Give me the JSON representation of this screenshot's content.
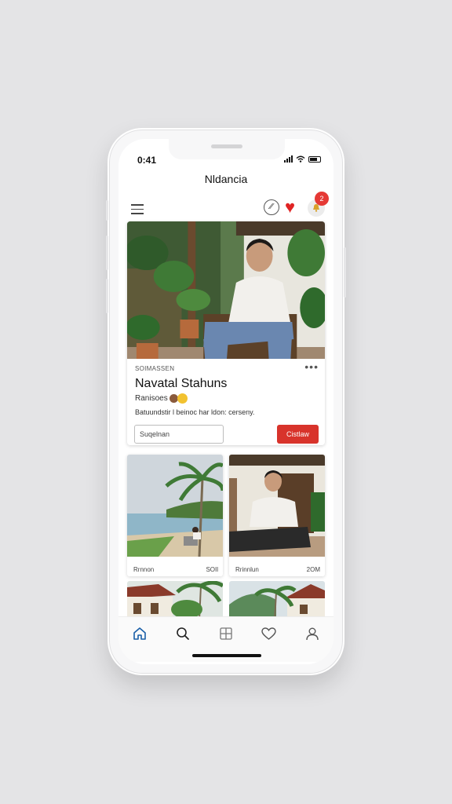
{
  "status_bar": {
    "time": "0:41"
  },
  "header": {
    "title": "Nldancia"
  },
  "topbar": {
    "menu_icon": "hamburger-icon",
    "compose_icon": "edit-icon",
    "compose_glyph": "⁄⁄",
    "favorite_icon": "heart-icon",
    "notification_icon": "bell-icon",
    "notification_count": "2"
  },
  "feature": {
    "meta": "SOIMASSEN",
    "title": "Navatal Stahuns",
    "subtitle": "Ranisoes",
    "description": "Batuundstir l beinoc har ldon: cerseny.",
    "input_value": "Suqelnan",
    "action_label": "Cistlaw"
  },
  "grid": [
    {
      "caption_left": "Rrnnon",
      "caption_right": "SOIl"
    },
    {
      "caption_left": "Rrinnlun",
      "caption_right": "2OM"
    }
  ],
  "bottom_nav": [
    {
      "icon": "home-icon",
      "active": true
    },
    {
      "icon": "search-icon",
      "active": false
    },
    {
      "icon": "grid-icon",
      "active": false
    },
    {
      "icon": "heart-icon",
      "active": false
    },
    {
      "icon": "profile-icon",
      "active": false
    }
  ],
  "colors": {
    "accent": "#d8332b",
    "heart": "#e02424",
    "active_nav": "#1a5fa8",
    "background": "#e4e4e6"
  }
}
